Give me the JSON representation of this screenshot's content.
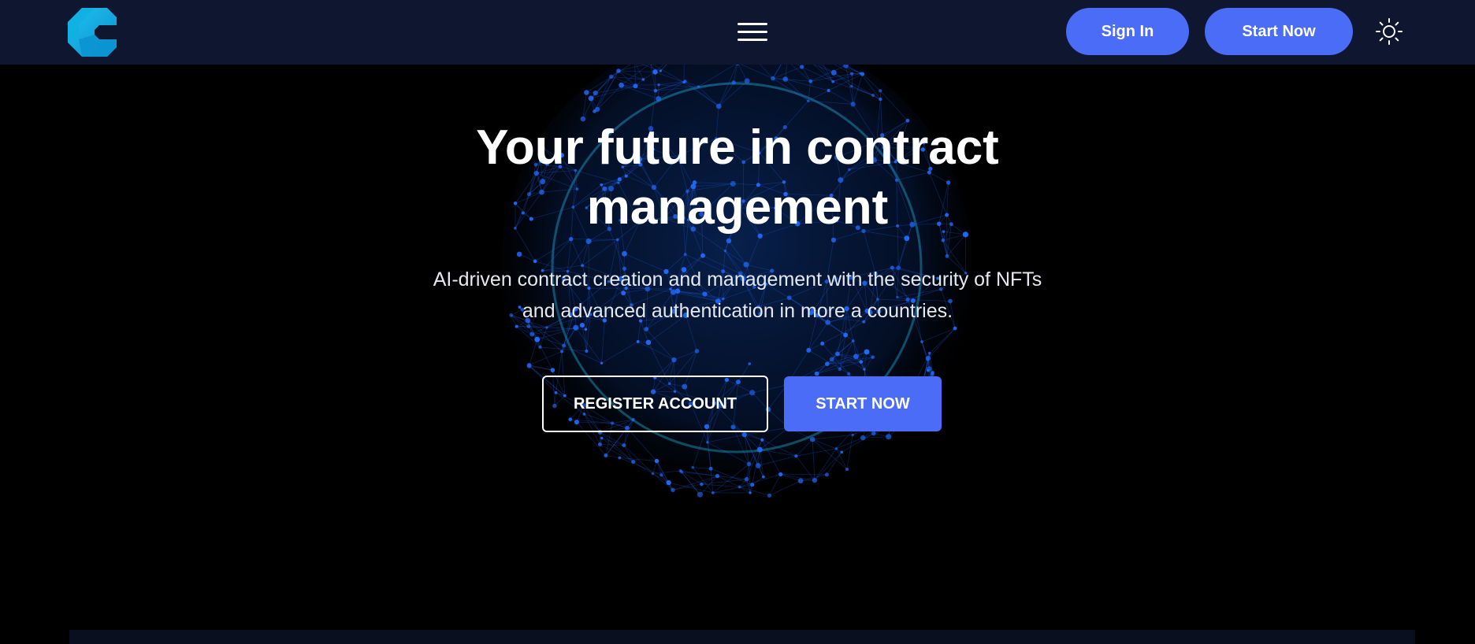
{
  "header": {
    "logo_icon": "brand-c-logo",
    "menu_icon": "hamburger-menu-icon",
    "sign_in_label": "Sign In",
    "start_now_label": "Start Now",
    "theme_icon": "sun-icon"
  },
  "hero": {
    "title_line1": "Your future in contract",
    "title_line2": "management",
    "subtitle_line1": "AI-driven contract creation and management with the security of NFTs",
    "subtitle_line2": "and advanced authentication in more a countries.",
    "register_label": "REGISTER ACCOUNT",
    "start_now_label": "START NOW",
    "background_icon": "network-globe-icon"
  },
  "colors": {
    "header_bg": "#0f1730",
    "page_bg": "#000000",
    "accent": "#4a6cf7",
    "globe_blue": "#1f6bff",
    "logo_cyan": "#17b6e6"
  }
}
